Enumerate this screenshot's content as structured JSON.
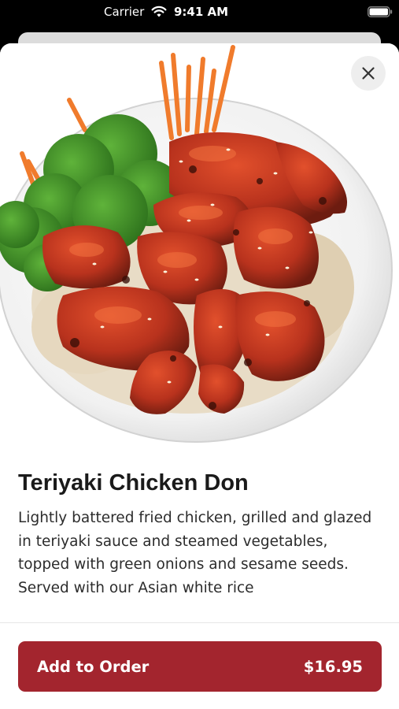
{
  "status_bar": {
    "carrier": "Carrier",
    "time": "9:41 AM"
  },
  "icons": {
    "close": "close-icon",
    "wifi": "wifi-icon",
    "battery": "battery-icon"
  },
  "dish": {
    "title": "Teriyaki Chicken Don",
    "description": "Lightly battered fried chicken, grilled and glazed in teriyaki sauce and steamed vegetables, topped with green onions and sesame seeds. Served with our Asian white rice"
  },
  "order": {
    "button_label": "Add to Order",
    "price": "$16.95"
  },
  "colors": {
    "accent": "#a3252e",
    "sheet_background": "#ffffff",
    "status_bar_background": "#000000"
  }
}
